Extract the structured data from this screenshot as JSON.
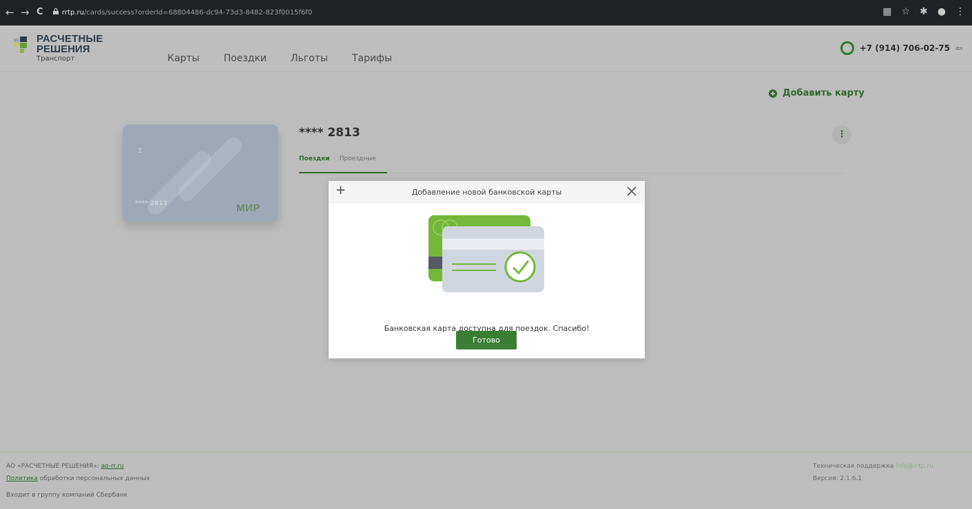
{
  "browser": {
    "url_host": "rrtp.ru",
    "url_path": "/cards/success?orderId=68804486-dc94-73d3-8482-823f0015f6f0",
    "back_icon": "←",
    "forward_icon": "→",
    "reload_icon": "C"
  },
  "header": {
    "logo_line1": "РАСЧЕТНЫЕ",
    "logo_line2": "РЕШЕНИЯ",
    "logo_line3": "Транспорт",
    "nav": [
      "Карты",
      "Поездки",
      "Льготы",
      "Тарифы"
    ],
    "phone": "+7 (914) 706-02-75"
  },
  "main": {
    "add_card_label": "Добавить карту",
    "card": {
      "index": "1",
      "masked": "**** 2813",
      "brand": "МИР"
    },
    "card_title": "**** 2813",
    "tabs": [
      "Поездки",
      "Проездные"
    ],
    "kebab": "⋮"
  },
  "modal": {
    "plus": "+",
    "title": "Добавление новой банковской карты",
    "message": "Банковская карта доступна для поездок. Спасибо!",
    "done_label": "Готово"
  },
  "footer": {
    "company_prefix": "АО «РАСЧЕТНЫЕ РЕШЕНИЯ»: ",
    "company_link": "ao-rr.ru",
    "policy_link": "Политика",
    "policy_rest": " обработки персональных данных",
    "group": "Входит в группу компаний Сбербанк",
    "support_label": "Техническая поддержка ",
    "support_email": "info@rrtp.ru",
    "version": "Версия: 2.1.6.1"
  },
  "colors": {
    "brand_green": "#2e6a2a",
    "button_green": "#3a7e33",
    "overlay_gray": "#bdbdbd"
  }
}
